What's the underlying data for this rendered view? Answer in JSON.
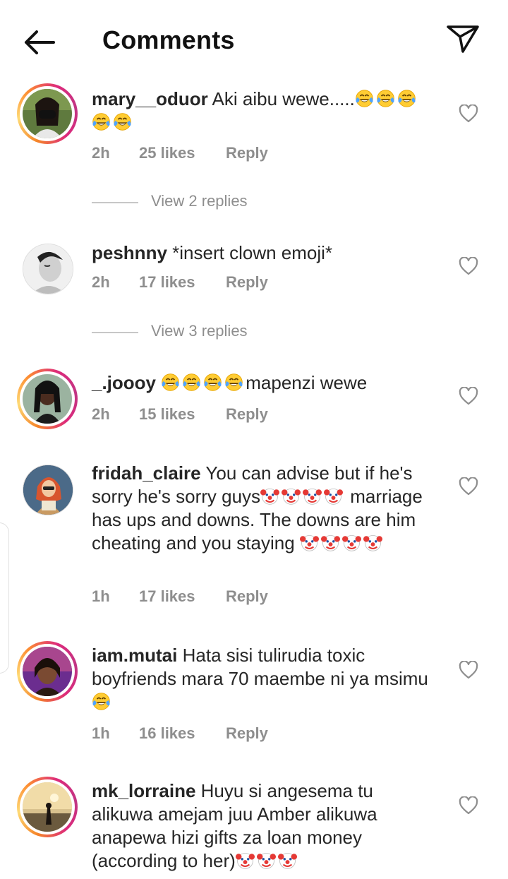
{
  "header": {
    "title": "Comments",
    "back_icon": "arrow-left-icon",
    "share_icon": "paper-plane-icon"
  },
  "comments": [
    {
      "username": "mary__oduor",
      "text": "Aki aibu wewe.....",
      "emojis_after": "😂😂😂😂😂",
      "time": "2h",
      "likes": "25 likes",
      "reply": "Reply",
      "view_replies": "View 2 replies",
      "has_story_ring": true
    },
    {
      "username": "peshnny",
      "text": "*insert clown emoji*",
      "time": "2h",
      "likes": "17 likes",
      "reply": "Reply",
      "view_replies": "View 3 replies",
      "has_story_ring": false
    },
    {
      "username": "_.joooy",
      "emojis_before": "😂😂😂😂",
      "text": "mapenzi wewe",
      "time": "2h",
      "likes": "15 likes",
      "reply": "Reply",
      "has_story_ring": true
    },
    {
      "username": "fridah_claire",
      "text_1": "You can advise but if he's sorry he's sorry guys",
      "emojis_mid": "🤡🤡🤡🤡",
      "text_2": "marriage has ups and downs. The downs are him cheating and you staying",
      "emojis_end": "🤡🤡🤡🤡",
      "time": "1h",
      "likes": "17 likes",
      "reply": "Reply",
      "has_story_ring": false
    },
    {
      "username": "iam.mutai",
      "text": "Hata sisi tulirudia toxic boyfriends mara 70 maembe ni ya msimu",
      "emojis_after": "😂",
      "time": "1h",
      "likes": "16 likes",
      "reply": "Reply",
      "has_story_ring": true
    },
    {
      "username": "mk_lorraine",
      "text": "Huyu si angesema tu alikuwa amejam juu Amber alikuwa anapewa hizi gifts za loan money (according to her)",
      "emojis_after": "🤡🤡🤡",
      "has_story_ring": true
    }
  ],
  "colors": {
    "text": "#262626",
    "muted": "#8e8e8e",
    "story_ring_start": "#f58529",
    "story_ring_end": "#dd2a7b"
  },
  "icons": {
    "like": "heart-outline-icon",
    "laugh_emoji": "face-with-tears-of-joy-icon",
    "clown_emoji": "clown-face-icon"
  }
}
